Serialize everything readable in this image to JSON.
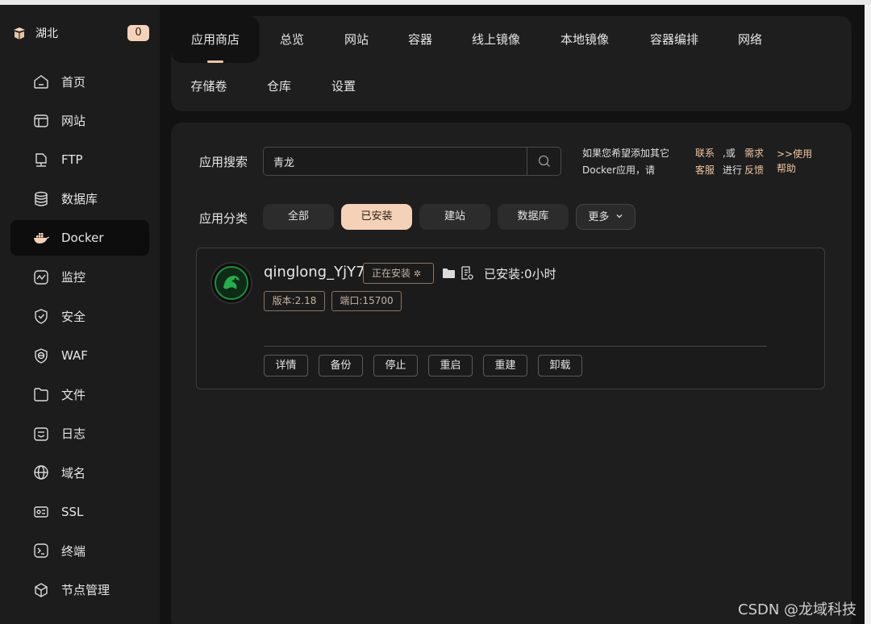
{
  "brand": {
    "name": "湖北",
    "badge": "0"
  },
  "sidebar": {
    "items": [
      {
        "label": "首页",
        "icon": "home-icon",
        "active": false
      },
      {
        "label": "网站",
        "icon": "website-icon",
        "active": false
      },
      {
        "label": "FTP",
        "icon": "ftp-icon",
        "active": false
      },
      {
        "label": "数据库",
        "icon": "database-icon",
        "active": false
      },
      {
        "label": "Docker",
        "icon": "docker-icon",
        "active": true
      },
      {
        "label": "监控",
        "icon": "monitor-icon",
        "active": false
      },
      {
        "label": "安全",
        "icon": "shield-icon",
        "active": false
      },
      {
        "label": "WAF",
        "icon": "waf-icon",
        "active": false
      },
      {
        "label": "文件",
        "icon": "folder-icon",
        "active": false
      },
      {
        "label": "日志",
        "icon": "log-icon",
        "active": false
      },
      {
        "label": "域名",
        "icon": "globe-icon",
        "active": false
      },
      {
        "label": "SSL",
        "icon": "ssl-icon",
        "active": false
      },
      {
        "label": "终端",
        "icon": "terminal-icon",
        "active": false
      },
      {
        "label": "节点管理",
        "icon": "node-icon",
        "active": false
      }
    ]
  },
  "tabs": [
    {
      "label": "应用商店",
      "active": true
    },
    {
      "label": "总览"
    },
    {
      "label": "网站"
    },
    {
      "label": "容器"
    },
    {
      "label": "线上镜像"
    },
    {
      "label": "本地镜像"
    },
    {
      "label": "容器编排"
    },
    {
      "label": "网络"
    },
    {
      "label": "存储卷"
    },
    {
      "label": "仓库"
    },
    {
      "label": "设置"
    }
  ],
  "search": {
    "label": "应用搜索",
    "value": "青龙",
    "hint_line1": "如果您希望添加其它",
    "hint_line2": "Docker应用，请",
    "link_contact_1": "联系",
    "link_contact_2": "客服",
    "sep_or": ",或",
    "link_req_1": "需求",
    "text_feedback_pre": "进行",
    "link_feedback": "反馈",
    "help_1": ">>使用",
    "help_2": "帮助"
  },
  "category": {
    "label": "应用分类",
    "items": [
      "全部",
      "已安装",
      "建站",
      "数据库"
    ],
    "active_index": 1,
    "more": "更多"
  },
  "app": {
    "name": "qinglong_YjY7",
    "status": "正在安装",
    "installed": "已安装:0小时",
    "version": "版本:2.18",
    "port": "端口:15700",
    "actions": [
      "详情",
      "备份",
      "停止",
      "重启",
      "重建",
      "卸载"
    ]
  },
  "colors": {
    "accent": "#f2c49d",
    "active_chip": "#f5d2b7",
    "panel": "#1e1e1e",
    "bg": "#121212"
  },
  "watermark": "CSDN @龙域科技"
}
